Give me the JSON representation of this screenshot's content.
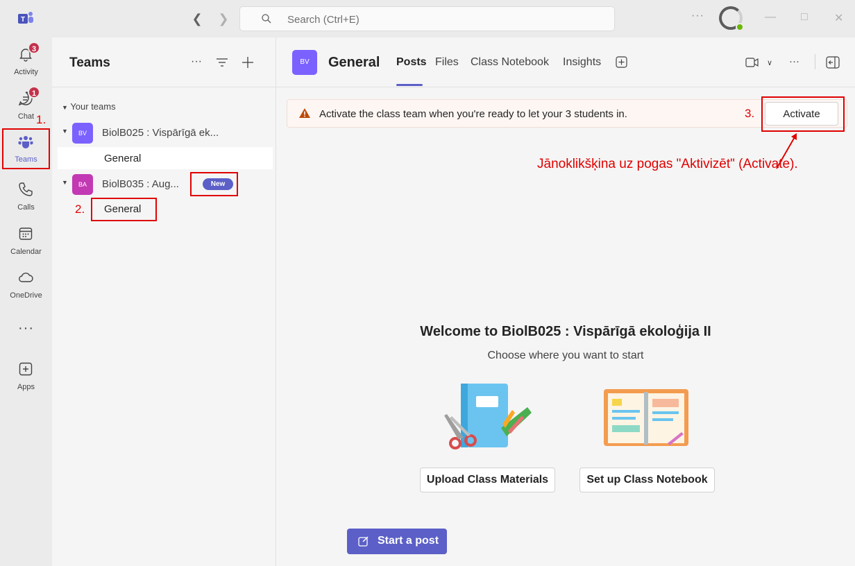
{
  "titlebar": {
    "search_placeholder": "Search (Ctrl+E)",
    "more": "···"
  },
  "rail": {
    "items": [
      {
        "label": "Activity",
        "badge": "3"
      },
      {
        "label": "Chat",
        "badge": "1"
      },
      {
        "label": "Teams"
      },
      {
        "label": "Calls"
      },
      {
        "label": "Calendar"
      },
      {
        "label": "OneDrive"
      },
      {
        "label": "Apps"
      }
    ],
    "more": "···"
  },
  "teams_pane": {
    "title": "Teams",
    "section_label": "Your teams",
    "teams": [
      {
        "initials": "BV",
        "name": "BiolB025 : Vispārīgā ek...",
        "color": "#7b61ff",
        "channels": [
          "General"
        ]
      },
      {
        "initials": "BA",
        "name": "BiolB035 : Aug...",
        "color": "#c239b3",
        "new_badge": "New",
        "channels": [
          "General"
        ]
      }
    ]
  },
  "main": {
    "channel_initials": "BV",
    "channel_title": "General",
    "tabs": [
      "Posts",
      "Files",
      "Class Notebook",
      "Insights"
    ],
    "banner_message": "Activate the class team when you're ready to let your 3 students in.",
    "activate_label": "Activate",
    "welcome_title": "Welcome to BiolB025 : Vispārīgā ekoloģija II",
    "welcome_subtitle": "Choose where you want to start",
    "upload_label": "Upload Class Materials",
    "notebook_label": "Set up Class Notebook",
    "start_post_label": "Start a post"
  },
  "annotations": {
    "step1": "1.",
    "step2": "2.",
    "step3": "3.",
    "instruction": "Jānoklikšķina uz pogas \"Aktivizēt\" (Activate).",
    "color": "#e00000"
  },
  "colors": {
    "accent": "#5b5fc7",
    "warning": "#bc4b09"
  }
}
